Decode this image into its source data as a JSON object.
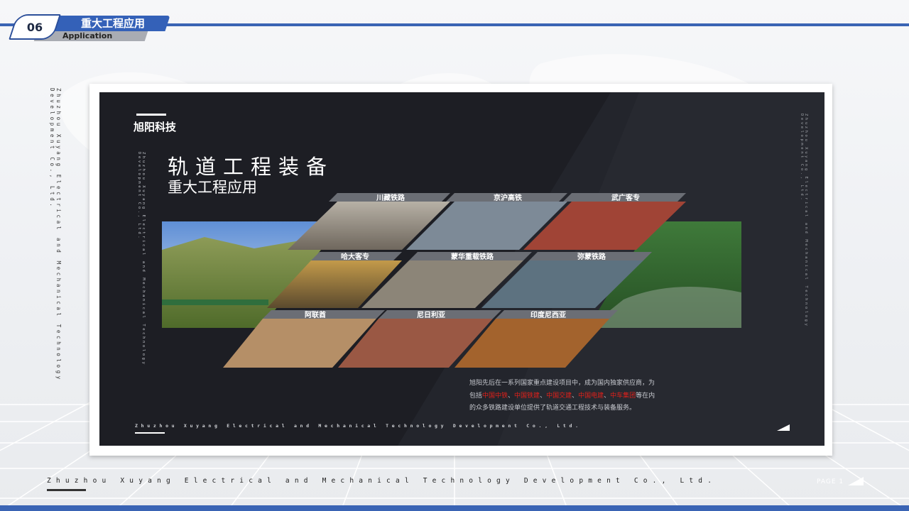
{
  "header": {
    "section_number": "06",
    "section_title": "重大工程应用",
    "section_subtitle": "Application"
  },
  "side_text": "Zhuzhou Xuyang Electrical and Mechanical Technology Development Co., Ltd.",
  "slide": {
    "brand": "旭阳科技",
    "title": "轨道工程装备",
    "subtitle": "重大工程应用",
    "vertical_text": "Zhuzhou Xuyang Electrical and Mechanical Technology Development Co., Ltd.",
    "photo_labels": [
      "川藏铁路",
      "京沪高铁",
      "武广客专",
      "哈大客专",
      "蒙华重载铁路",
      "弥蒙铁路",
      "阿联酋",
      "尼日利亚",
      "印度尼西亚"
    ],
    "description": {
      "line1": "旭阳先后在一系列国家重点建设项目中，成为国内独家供应商，为",
      "prefix": "包括",
      "customers": [
        "中国中铁",
        "中国铁建",
        "中国交建",
        "中国电建",
        "中车集团"
      ],
      "separator": "、",
      "suffix": "等在内",
      "line3": "的众多铁路建设单位提供了轨道交通工程技术与装备服务。"
    },
    "footer_text": "Zhuzhou Xuyang Electrical and Mechanical Technology Development Co., Ltd."
  },
  "footer": {
    "company": "Zhuzhou Xuyang Electrical and Mechanical Technology Development Co., Ltd.",
    "page_label": "PAGE 1"
  },
  "colors": {
    "accent": "#3a64b4",
    "slide_bg": "#1d1e24",
    "highlight": "#e0201a",
    "label_bar": "#6b6e75"
  }
}
